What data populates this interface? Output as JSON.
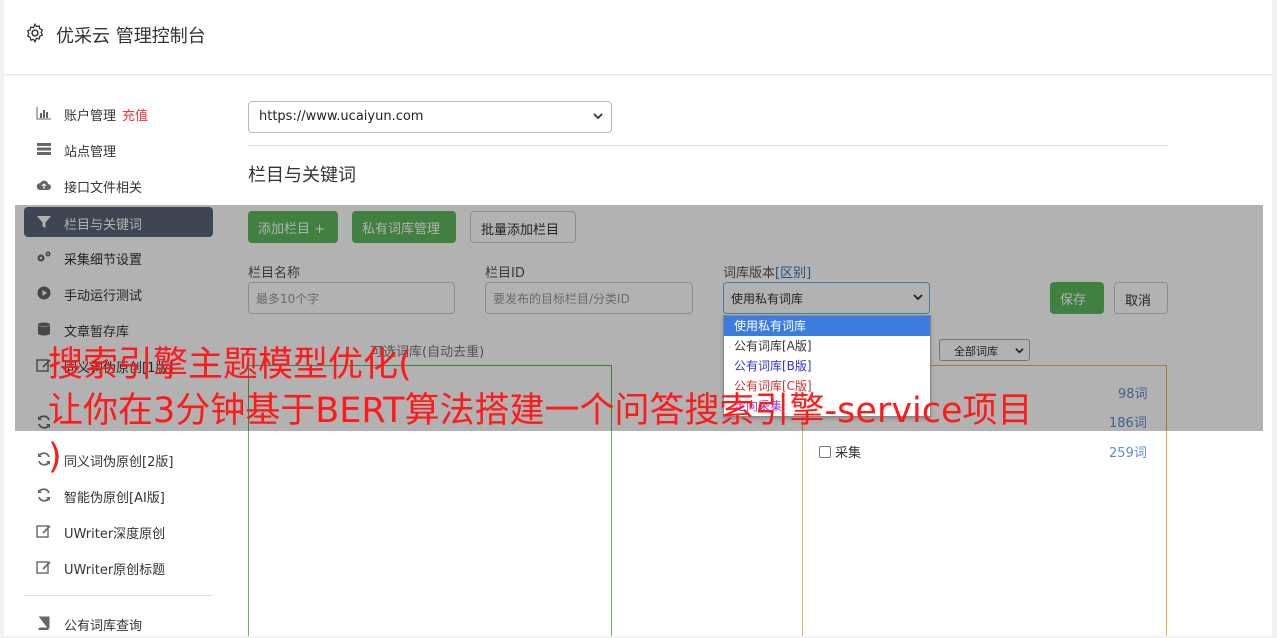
{
  "header": {
    "title": "优采云 管理控制台",
    "icon": "gear-icon"
  },
  "sidebar": {
    "items": [
      {
        "label": "账户管理",
        "extra": "充值",
        "icon": "bar-chart-icon",
        "active": false
      },
      {
        "label": "站点管理",
        "extra": "",
        "icon": "server-icon",
        "active": false
      },
      {
        "label": "接口文件相关",
        "extra": "",
        "icon": "cloud-upload-icon",
        "active": false
      },
      {
        "label": "栏目与关键词",
        "extra": "",
        "icon": "filter-icon",
        "active": true
      },
      {
        "label": "采集细节设置",
        "extra": "",
        "icon": "gears-icon",
        "active": false
      },
      {
        "label": "手动运行测试",
        "extra": "",
        "icon": "play-circle-icon",
        "active": false
      },
      {
        "label": "文章暂存库",
        "extra": "",
        "icon": "database-icon",
        "active": false
      },
      {
        "label": "同义词伪原创[1版]",
        "extra": "",
        "icon": "refresh-icon",
        "active": false
      },
      {
        "label": "同义词伪原创[2版]",
        "extra": "",
        "icon": "refresh-icon",
        "active": false
      },
      {
        "label": "智能伪原创[AI版]",
        "extra": "",
        "icon": "refresh-icon",
        "active": false
      },
      {
        "label": "UWriter深度原创",
        "extra": "",
        "icon": "edit-icon",
        "active": false
      },
      {
        "label": "UWriter原创标题",
        "extra": "",
        "icon": "edit-icon",
        "active": false
      },
      {
        "label": "公有词库查询",
        "extra": "",
        "icon": "book-icon",
        "active": false
      }
    ]
  },
  "site_select": {
    "value": "https://www.ucaiyun.com"
  },
  "section": {
    "title": "栏目与关键词"
  },
  "toolbar": {
    "add_column": "添加栏目 +",
    "private_lib": "私有词库管理",
    "bulk_add": "批量添加栏目"
  },
  "form": {
    "name_label": "栏目名称",
    "name_placeholder": "最多10个字",
    "id_label": "栏目ID",
    "id_placeholder": "要发布的目标栏目/分类ID",
    "version_label": "词库版本",
    "version_link": "[区别]",
    "version_value": "使用私有词库",
    "save": "保存",
    "cancel": "取消"
  },
  "version_options": [
    {
      "label": "使用私有词库",
      "color": "#ffffff",
      "selected": true
    },
    {
      "label": "公有词库[A版]",
      "color": "#333333",
      "selected": false
    },
    {
      "label": "公有词库[B版]",
      "color": "#3333cc",
      "selected": false
    },
    {
      "label": "公有词库[C版]",
      "color": "#cc3333",
      "selected": false
    },
    {
      "label": "定向采集",
      "color": "#9933cc",
      "selected": false
    }
  ],
  "lists": {
    "left_caption": "可选词库(自动去重)",
    "filter_value": "全部词库",
    "counts": [
      "98词",
      "186词",
      "259词"
    ],
    "row_label": "采集"
  },
  "banner": {
    "lines": [
      "搜索引擎主题模型优化(",
      "让你在3分钟基于BERT算法搭建一个问答搜索引擎-service项目",
      ")"
    ]
  },
  "colors": {
    "accent_green": "#5cb85c",
    "active_nav": "#5a6577",
    "banner_red": "#ff1a1a",
    "orange_border": "#f0ad4e"
  }
}
